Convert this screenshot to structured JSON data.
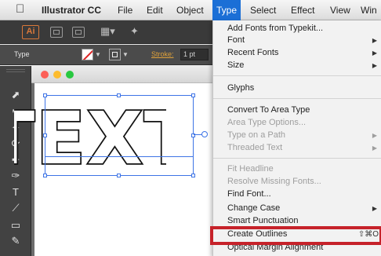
{
  "menubar": {
    "app_name": "Illustrator CC",
    "items": [
      "File",
      "Edit",
      "Object",
      "Type",
      "Select",
      "Effect",
      "View",
      "Win"
    ],
    "active": "Type"
  },
  "app_bar": {
    "logo": "Ai"
  },
  "control_bar": {
    "type_label": "Type",
    "stroke_label": "Stroke:",
    "stroke_value": "1 pt"
  },
  "artwork": {
    "text": "TEXT"
  },
  "type_menu": {
    "items": [
      {
        "label": "Add Fonts from Typekit...",
        "enabled": true
      },
      {
        "label": "Font",
        "enabled": true,
        "submenu": true
      },
      {
        "label": "Recent Fonts",
        "enabled": true,
        "submenu": true
      },
      {
        "label": "Size",
        "enabled": true,
        "submenu": true
      },
      {
        "label": "Glyphs",
        "enabled": true
      },
      {
        "label": "Convert To Area Type",
        "enabled": true
      },
      {
        "label": "Area Type Options...",
        "enabled": false
      },
      {
        "label": "Type on a Path",
        "enabled": false,
        "submenu": true
      },
      {
        "label": "Threaded Text",
        "enabled": false,
        "submenu": true
      },
      {
        "label": "Fit Headline",
        "enabled": false
      },
      {
        "label": "Resolve Missing Fonts...",
        "enabled": false
      },
      {
        "label": "Find Font...",
        "enabled": true
      },
      {
        "label": "Change Case",
        "enabled": true,
        "submenu": true
      },
      {
        "label": "Smart Punctuation",
        "enabled": true
      },
      {
        "label": "Create Outlines",
        "enabled": true,
        "shortcut": "⇧⌘O"
      },
      {
        "label": "Optical Margin Alignment",
        "enabled": true
      }
    ]
  },
  "colors": {
    "menu_highlight": "#1b6fd6",
    "callout": "#c6222a",
    "selection": "#3e74e6",
    "ai_orange": "#d9783a"
  },
  "icons": [
    "apple-icon",
    "ai-logo-icon",
    "selection-tool-icon",
    "direct-selection-tool-icon",
    "magic-wand-tool-icon",
    "lasso-tool-icon",
    "pen-tool-icon",
    "brush-tool-icon",
    "type-tool-icon",
    "line-tool-icon",
    "rectangle-tool-icon",
    "pencil-tool-icon"
  ]
}
